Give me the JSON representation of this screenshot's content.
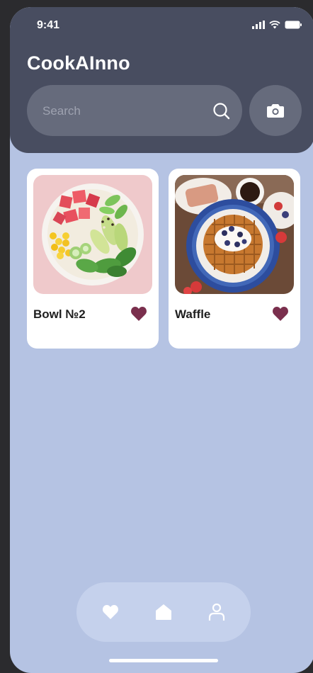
{
  "status_bar": {
    "time": "9:41"
  },
  "app": {
    "title": "CookAInno"
  },
  "search": {
    "placeholder": "Search",
    "value": ""
  },
  "recipes": [
    {
      "title": "Bowl №2",
      "favorited": true
    },
    {
      "title": "Waffle",
      "favorited": true
    }
  ],
  "colors": {
    "header_bg": "#484d60",
    "screen_bg": "#b5c3e3",
    "heart": "#7a2f4d",
    "search_bg": "#666b7c"
  },
  "icons": {
    "search": "search-icon",
    "camera": "camera-icon",
    "favorite": "heart-icon",
    "nav_favorites": "heart-icon",
    "nav_home": "home-icon",
    "nav_profile": "user-icon"
  }
}
